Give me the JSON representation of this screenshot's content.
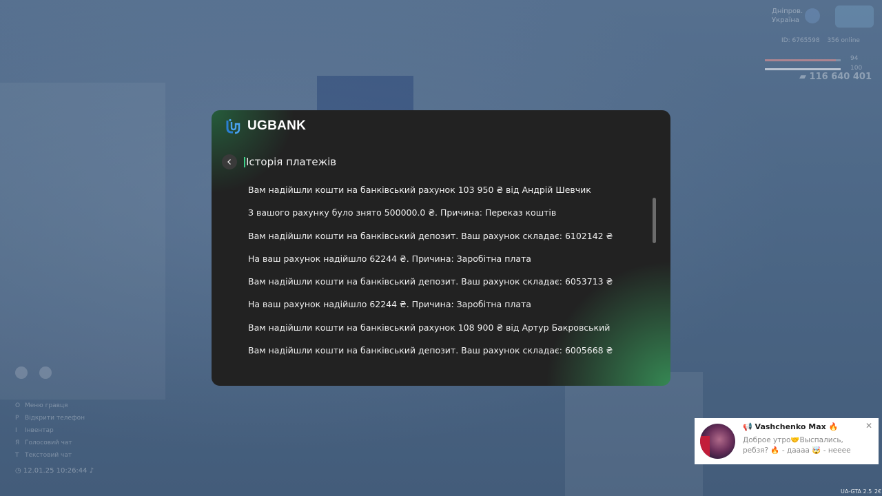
{
  "hud": {
    "region": "Дніпров. Україна",
    "player_id": "ID: 6765598",
    "online": "356 online",
    "bar_top_value": "94",
    "bar_top_fraction": 0.94,
    "bar_bottom_value": "100",
    "bar_bottom_fraction": 1.0,
    "money": "116 640 401",
    "keys": [
      {
        "key": "О",
        "label": "Меню гравця"
      },
      {
        "key": "P",
        "label": "Відкрити телефон"
      },
      {
        "key": "I",
        "label": "Інвентар"
      },
      {
        "key": "Я",
        "label": "Голосовий чат"
      },
      {
        "key": "T",
        "label": "Текстовий чат"
      }
    ],
    "datetime": "12.01.25 10:26:44"
  },
  "bank": {
    "brand": "UGBANK",
    "section_title": "Історія платежів",
    "history": [
      "Вам надійшли кошти на банківський рахунок 103 950 ₴ від Андрій Шевчик",
      "З вашого рахунку було знято 500000.0 ₴. Причина: Переказ коштів",
      "Вам надійшли кошти на банківський депозит. Ваш рахунок складає: 6102142 ₴",
      "На ваш рахунок надійшло 62244 ₴. Причина: Заробітна плата",
      "Вам надійшли кошти на банківський депозит. Ваш рахунок складає: 6053713 ₴",
      "На ваш рахунок надійшло 62244 ₴. Причина: Заробітна плата",
      "Вам надійшли кошти на банківський рахунок 108 900 ₴ від Артур Бакровський",
      "Вам надійшли кошти на банківський депозит. Ваш рахунок складає: 6005668 ₴"
    ],
    "accent_color": "#3fd08a",
    "logo_color": "#2a7fd4"
  },
  "notification": {
    "author": "📢 Vashchenko Max 🔥",
    "message": "Доброе утро🤝Выспались, ребзя? 🔥 - даааа 🤯 - нееее",
    "close_icon": "close-icon"
  },
  "version": "UA-GTA 2.5",
  "version_extra": "2€"
}
